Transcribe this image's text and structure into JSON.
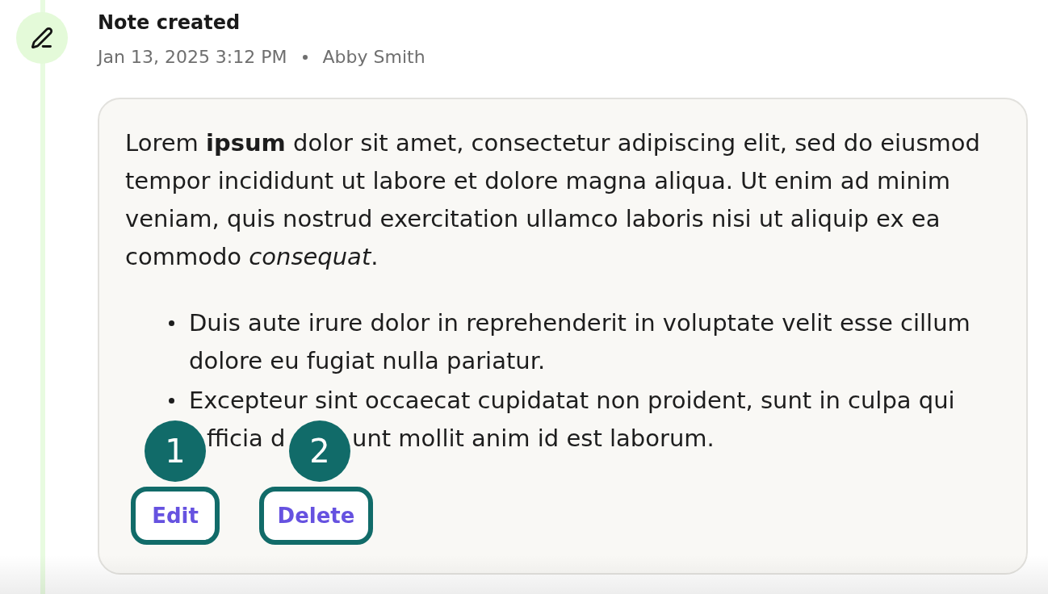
{
  "timeline_entry": {
    "title": "Note created",
    "timestamp": "Jan 13, 2025 3:12 PM",
    "author": "Abby Smith",
    "note": {
      "paragraph": "Lorem **ipsum** dolor sit amet, consectetur adipiscing elit, sed do eiusmod tempor incididunt ut labore et dolore magna aliqua. Ut enim ad minim veniam, quis nostrud exercitation ullamco laboris nisi ut aliquip ex ea commodo *consequat*.",
      "bullets": [
        {
          "kind": "text",
          "text": "Duis aute irure dolor in reprehenderit in voluptate velit esse cillum dolore eu fugiat nulla pariatur."
        },
        {
          "kind": "covered",
          "text": "Excepteur sint occaecat cupidatat non proident, sunt in culpa qui",
          "visible_fragments": [
            "fficia d",
            "unt mollit anim id est laborum."
          ]
        }
      ]
    },
    "actions": [
      {
        "label": "Edit",
        "callout": "1",
        "highlighted": true
      },
      {
        "label": "Delete",
        "callout": "2",
        "highlighted": true
      }
    ]
  }
}
